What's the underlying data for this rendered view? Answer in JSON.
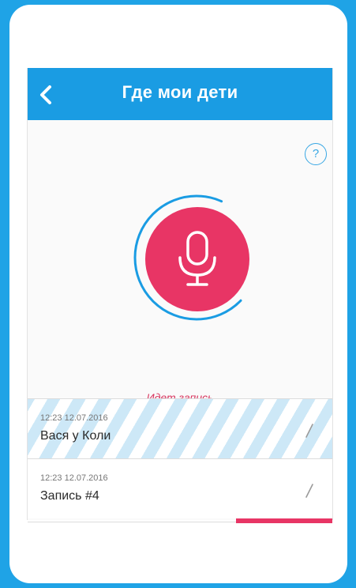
{
  "header": {
    "title": "Где мои дети",
    "back_icon": "chevron-left-icon"
  },
  "help": {
    "label": "?"
  },
  "recorder": {
    "status": "Идет запись",
    "mic_icon": "microphone-icon",
    "accent_color": "#e83565",
    "ring_color": "#1a9ce3"
  },
  "recordings": [
    {
      "time": "12:23  12.07.2016",
      "name": "Вася у Коли"
    },
    {
      "time": "12:23  12.07.2016",
      "name": "Запись #4"
    }
  ],
  "colors": {
    "background": "#1fa3e6",
    "header": "#1a9ce3"
  }
}
